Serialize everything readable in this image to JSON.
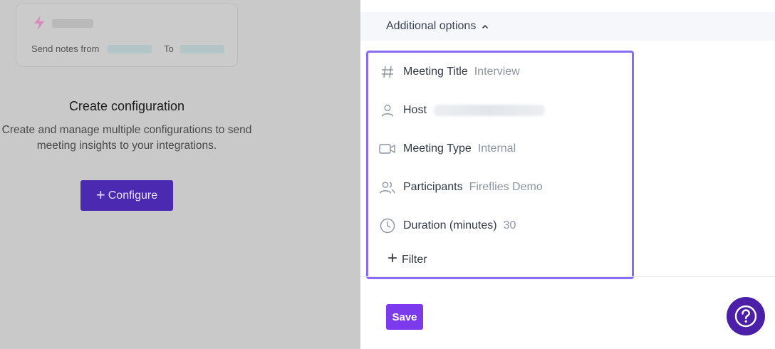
{
  "left": {
    "card": {
      "send_notes_label": "Send notes from",
      "to_label": "To"
    },
    "create_title": "Create configuration",
    "create_description": "Create and manage multiple configurations to send meeting insights to your integrations.",
    "configure_button": "Configure"
  },
  "right": {
    "additional_options_label": "Additional options",
    "filters": [
      {
        "icon": "hash-icon",
        "name": "Meeting Title",
        "value": "Interview"
      },
      {
        "icon": "person-icon",
        "name": "Host",
        "value": ""
      },
      {
        "icon": "video-icon",
        "name": "Meeting Type",
        "value": "Internal"
      },
      {
        "icon": "users-icon",
        "name": "Participants",
        "value": "Fireflies Demo"
      },
      {
        "icon": "clock-icon",
        "name": "Duration (minutes)",
        "value": "30"
      }
    ],
    "add_filter_label": "Filter",
    "save_label": "Save"
  },
  "colors": {
    "accent": "#7c3aed",
    "configure_button": "#4b2ab1",
    "highlight_border": "#8a6cf2",
    "help_button": "#4b1fa8"
  }
}
